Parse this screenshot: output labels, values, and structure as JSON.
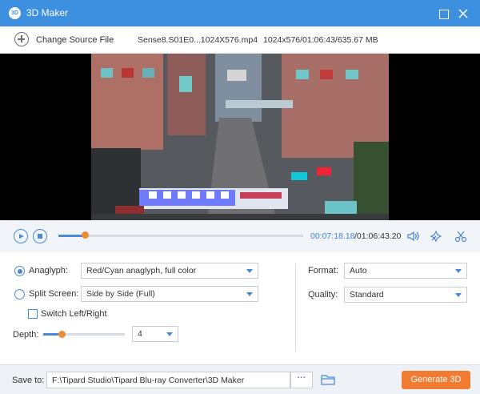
{
  "window": {
    "title": "3D Maker",
    "icon_text": "3D"
  },
  "source": {
    "change_label": "Change Source File",
    "file_name": "Sense8.S01E0...1024X576.mp4",
    "file_info": "1024x576/01:06:43/635.67 MB"
  },
  "player": {
    "current_time": "00:07:18.18",
    "total_time": "/01:06:43.20",
    "progress_fraction": 0.11
  },
  "settings": {
    "anaglyph": {
      "label": "Anaglyph:",
      "value": "Red/Cyan anaglyph, full color",
      "selected": true
    },
    "split_screen": {
      "label": "Split Screen:",
      "value": "Side by Side (Full)",
      "selected": false
    },
    "switch_left_right": {
      "label": "Switch Left/Right",
      "checked": false
    },
    "depth": {
      "label": "Depth:",
      "value": "4",
      "fraction": 0.23
    },
    "format": {
      "label": "Format:",
      "value": "Auto"
    },
    "quality": {
      "label": "Quality:",
      "value": "Standard"
    }
  },
  "save": {
    "label": "Save to:",
    "path": "F:\\Tipard Studio\\Tipard Blu-ray Converter\\3D Maker",
    "browse_label": "···",
    "generate_label": "Generate 3D"
  },
  "colors": {
    "accent": "#3d8fe0",
    "slider_thumb": "#f08a34",
    "generate_button": "#f07b31"
  }
}
